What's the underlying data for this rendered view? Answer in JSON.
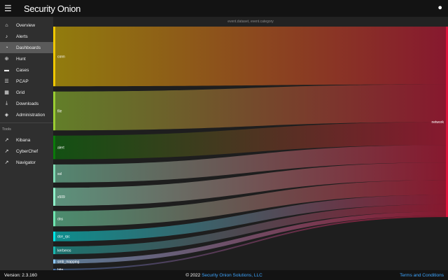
{
  "app": {
    "title": "Security Onion",
    "menu_icon": "menu-icon",
    "user_icon": "account-icon"
  },
  "sidebar": {
    "items": [
      {
        "label": "Overview",
        "icon": "home-icon",
        "glyph": "⌂"
      },
      {
        "label": "Alerts",
        "icon": "bell-icon",
        "glyph": "♪"
      },
      {
        "label": "Dashboards",
        "icon": "chart-pie-icon",
        "glyph": "◔",
        "active": true
      },
      {
        "label": "Hunt",
        "icon": "crosshairs-icon",
        "glyph": "⊕"
      },
      {
        "label": "Cases",
        "icon": "briefcase-icon",
        "glyph": "▬"
      },
      {
        "label": "PCAP",
        "icon": "list-icon",
        "glyph": "☰"
      },
      {
        "label": "Grid",
        "icon": "sitemap-icon",
        "glyph": "▦"
      },
      {
        "label": "Downloads",
        "icon": "download-icon",
        "glyph": "⤓"
      },
      {
        "label": "Administration",
        "icon": "shield-icon",
        "glyph": "◈"
      }
    ],
    "tools_label": "Tools",
    "tools": [
      {
        "label": "Kibana",
        "icon": "external-link-icon",
        "glyph": "↗"
      },
      {
        "label": "CyberChef",
        "icon": "external-link-icon",
        "glyph": "↗"
      },
      {
        "label": "Navigator",
        "icon": "external-link-icon",
        "glyph": "↗"
      }
    ]
  },
  "chart_data": {
    "type": "sankey",
    "title": "event.dataset, event.category",
    "sources": [
      {
        "name": "conn",
        "value": 86,
        "color": "#f0c800"
      },
      {
        "name": "file",
        "value": 56,
        "color": "#9acd32"
      },
      {
        "name": "alert",
        "value": 34,
        "color": "#0a7a0a"
      },
      {
        "name": "ssl",
        "value": 26,
        "color": "#7fdcb4"
      },
      {
        "name": "x509",
        "value": 26,
        "color": "#8ef0c8"
      },
      {
        "name": "dns",
        "value": 22,
        "color": "#70e6b0"
      },
      {
        "name": "dce_rpc",
        "value": 14,
        "color": "#00e8e8"
      },
      {
        "name": "kerberos",
        "value": 11,
        "color": "#1ab8b0"
      },
      {
        "name": "smb_mapping",
        "value": 6,
        "color": "#8cc8f8"
      },
      {
        "name": "http",
        "value": 2,
        "color": "#4a7ab4"
      }
    ],
    "targets": [
      {
        "name": "network",
        "color": "#dc143c"
      }
    ]
  },
  "footer": {
    "version": "Version: 2.3.160",
    "copyright": "© 2022 ",
    "company": "Security Onion Solutions, LLC",
    "terms": "Terms and Conditions"
  }
}
